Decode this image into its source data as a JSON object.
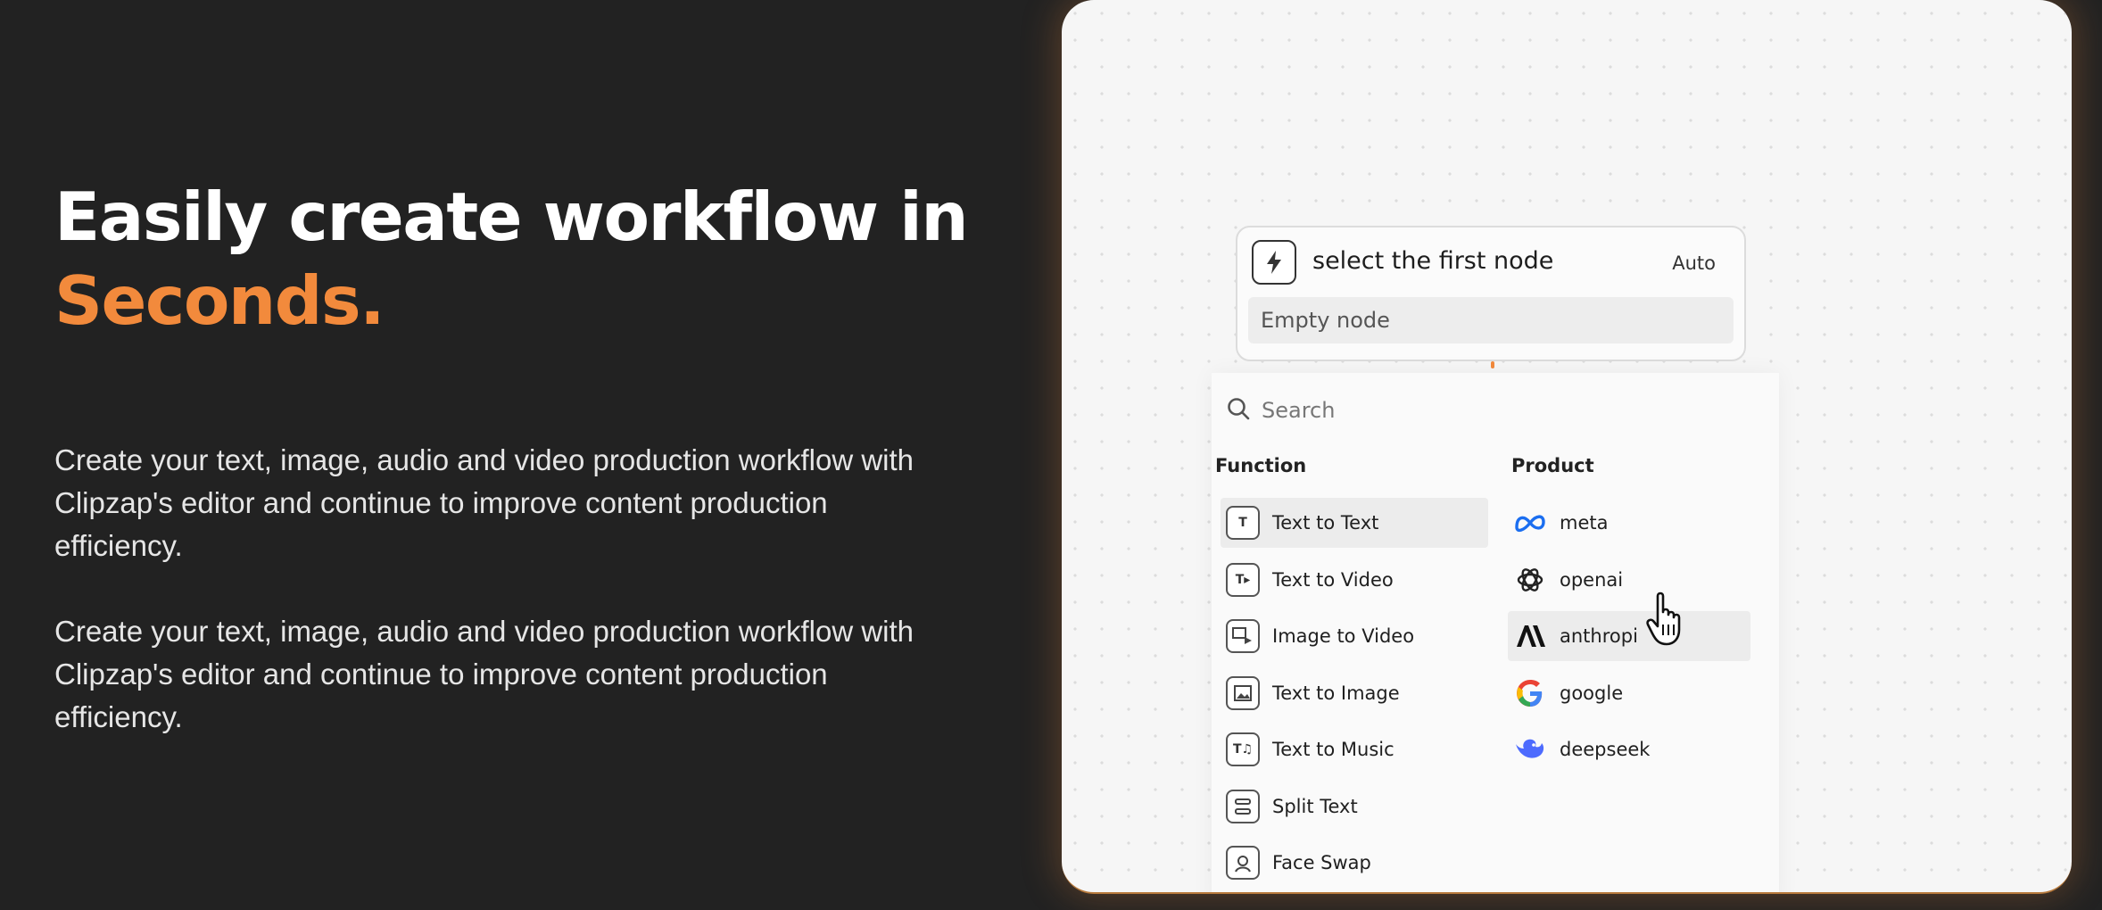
{
  "hero": {
    "headline_line1": "Easily create workflow in",
    "headline_line2": "Seconds.",
    "paragraph1": "Create your text, image, audio and video production workflow with Clipzap's editor and continue to improve content production efficiency.",
    "paragraph2": "Create your text, image, audio and video production workflow with Clipzap's editor and continue to improve content production efficiency."
  },
  "colors": {
    "background": "#222222",
    "accent": "#f28a3c",
    "panel": "#f6f6f6"
  },
  "node": {
    "icon": "lightning-icon",
    "title": "select the first node",
    "mode": "Auto",
    "subtitle": "Empty node"
  },
  "dropdown": {
    "search_label": "Search",
    "function_header": "Function",
    "product_header": "Product",
    "functions": [
      {
        "label": "Text to Text",
        "icon": "text-to-text-icon",
        "highlighted": true
      },
      {
        "label": "Text to Video",
        "icon": "text-to-video-icon"
      },
      {
        "label": "Image to Video",
        "icon": "image-to-video-icon"
      },
      {
        "label": "Text to Image",
        "icon": "text-to-image-icon"
      },
      {
        "label": "Text to Music",
        "icon": "text-to-music-icon"
      },
      {
        "label": "Split Text",
        "icon": "split-text-icon"
      },
      {
        "label": "Face Swap",
        "icon": "face-swap-icon"
      }
    ],
    "products": [
      {
        "label": "meta",
        "icon": "meta-logo-icon"
      },
      {
        "label": "openai",
        "icon": "openai-logo-icon"
      },
      {
        "label": "anthropi",
        "icon": "anthropic-logo-icon",
        "highlighted": true
      },
      {
        "label": "google",
        "icon": "google-logo-icon"
      },
      {
        "label": "deepseek",
        "icon": "deepseek-logo-icon"
      }
    ]
  }
}
